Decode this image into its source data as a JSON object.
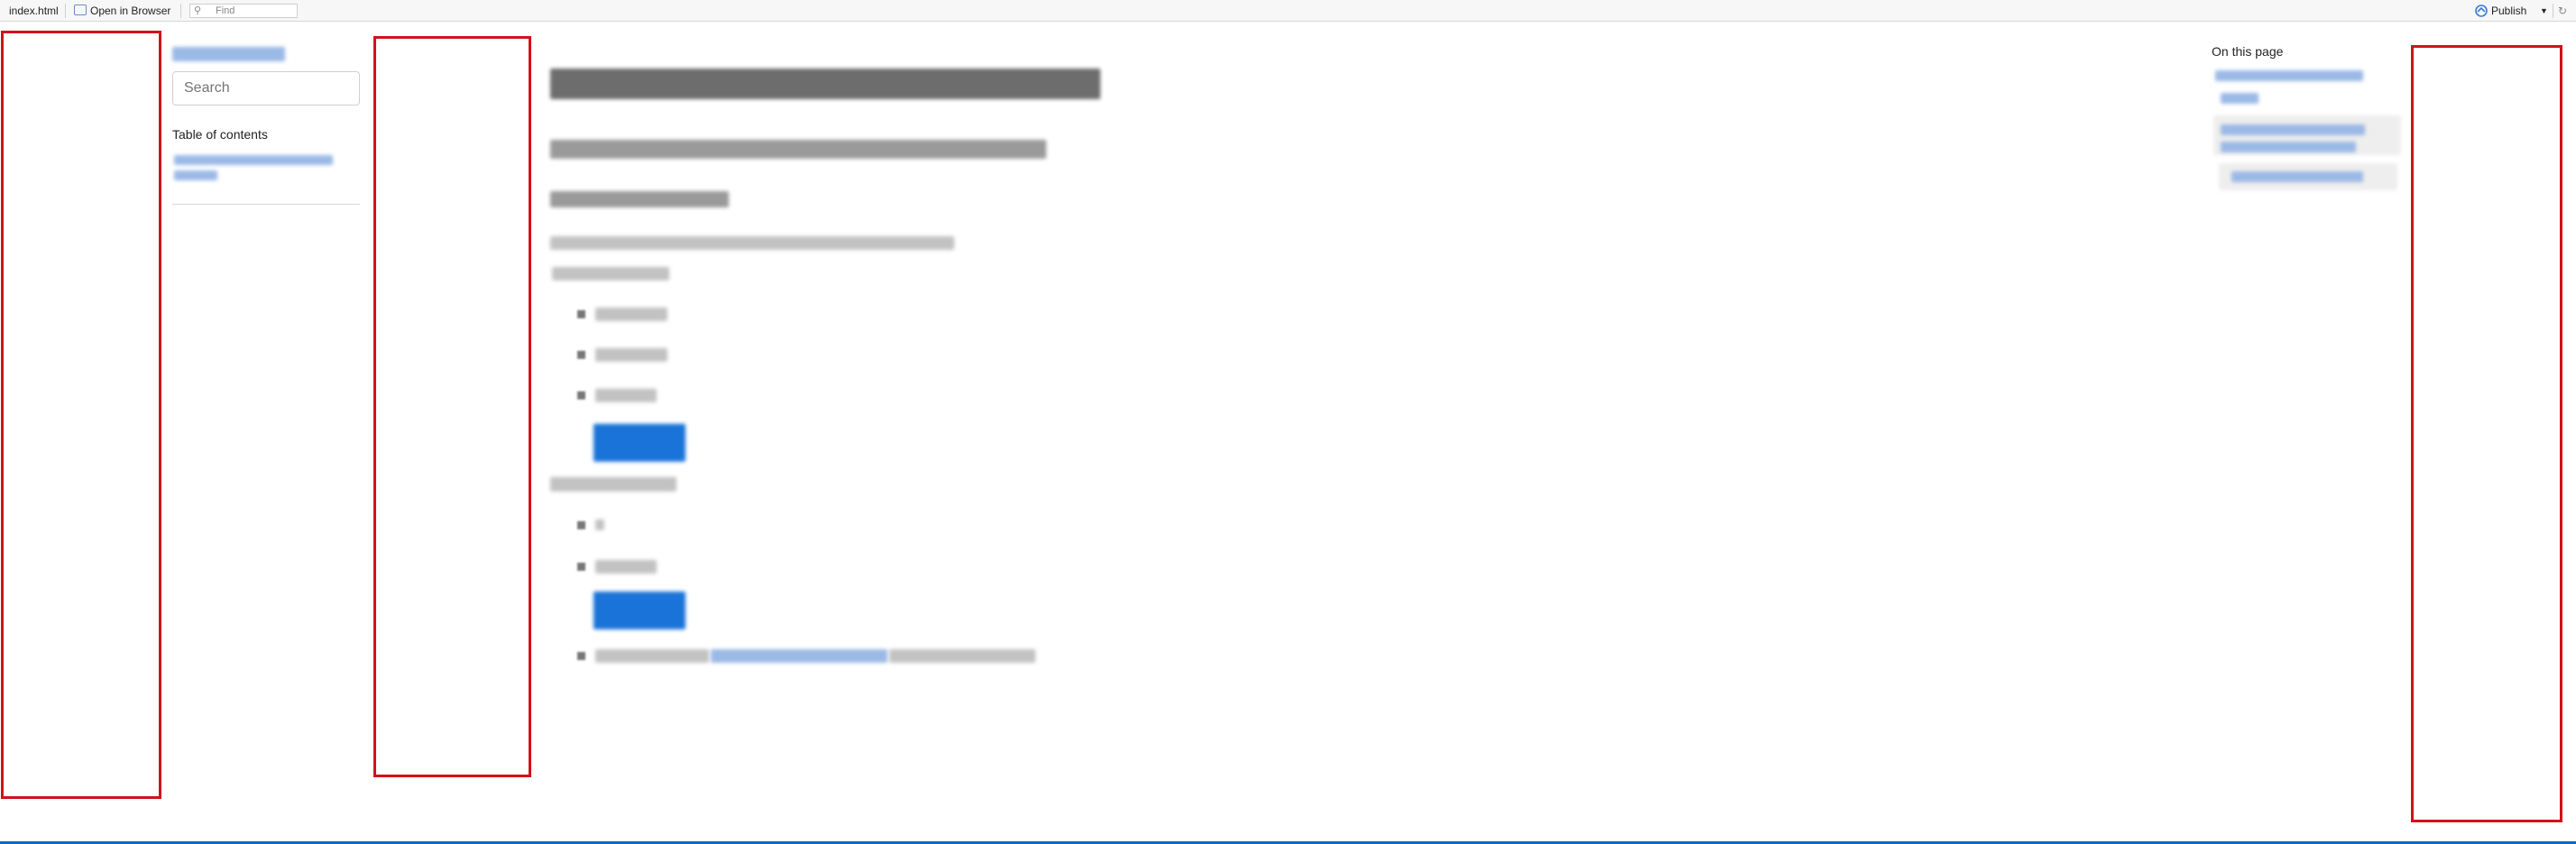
{
  "toolbar": {
    "filename": "index.html",
    "open_in_browser": "Open in Browser",
    "find_placeholder": "Find",
    "publish": "Publish"
  },
  "sidebar": {
    "search_placeholder": "Search",
    "toc_title": "Table of contents"
  },
  "right_toc": {
    "title": "On this page"
  },
  "icons": {
    "search": "search-icon",
    "open_in_browser": "browser-icon",
    "publish": "publish-icon",
    "dropdown": "chevron-down-icon",
    "refresh": "refresh-icon"
  },
  "colors": {
    "highlight_box": "#d0121b",
    "accent": "#1a73d9",
    "footer": "#1565c0"
  }
}
